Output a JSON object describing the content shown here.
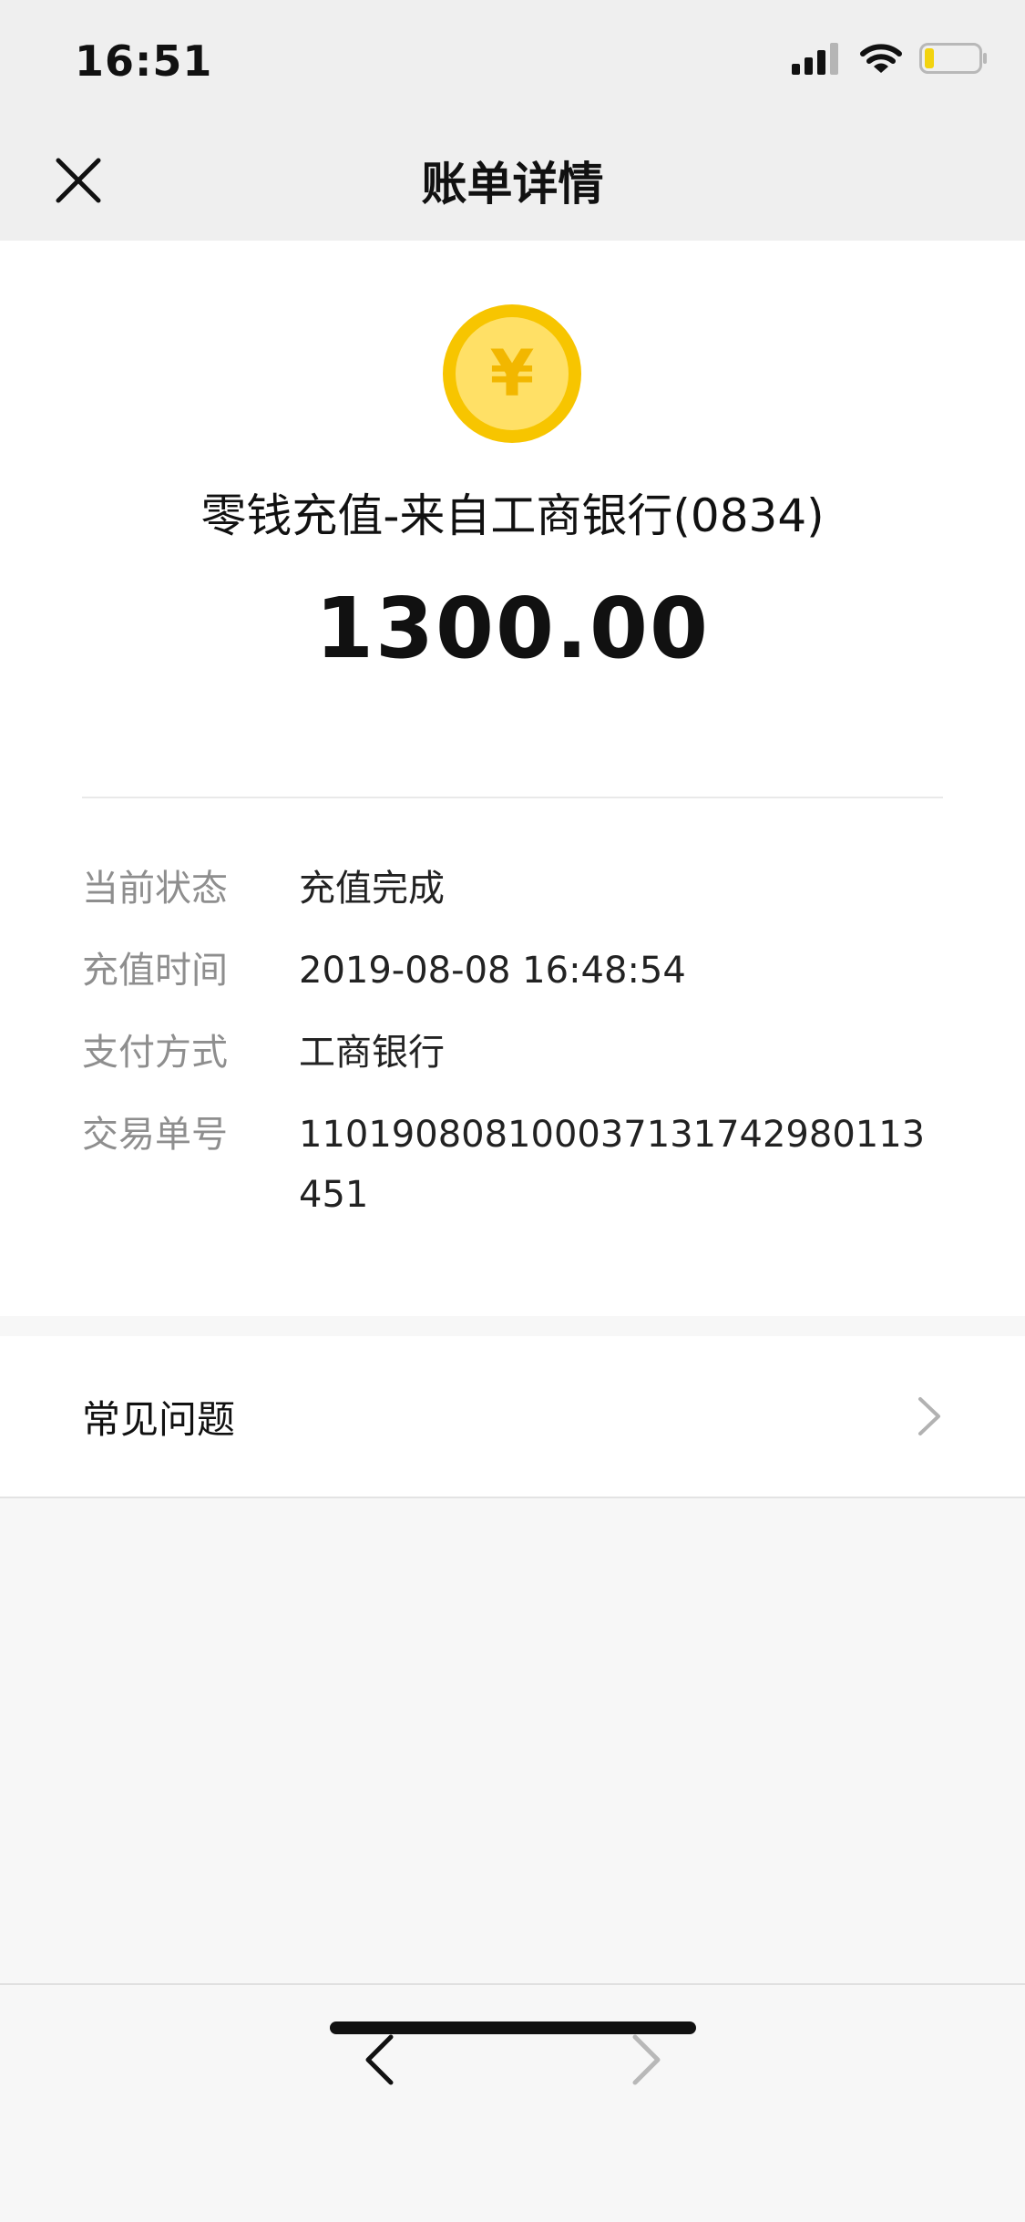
{
  "status_bar": {
    "time": "16:51"
  },
  "nav": {
    "title": "账单详情"
  },
  "bill": {
    "title": "零钱充值-来自工商银行(0834)",
    "amount": "1300.00",
    "coin_symbol": "¥"
  },
  "details": [
    {
      "label": "当前状态",
      "value": "充值完成"
    },
    {
      "label": "充值时间",
      "value": "2019-08-08 16:48:54"
    },
    {
      "label": "支付方式",
      "value": "工商银行"
    },
    {
      "label": "交易单号",
      "value": "110190808100037131742980113451"
    }
  ],
  "faq": {
    "label": "常见问题"
  },
  "icons": {
    "close": "close-icon",
    "coin": "yuan-coin-icon",
    "faq_arrow": "chevron-right-icon",
    "back": "chevron-left-icon",
    "forward": "chevron-right-icon"
  },
  "colors": {
    "coin_outer": "#F7C500",
    "coin_inner": "#FFE066",
    "label": "#8E8E8E"
  }
}
